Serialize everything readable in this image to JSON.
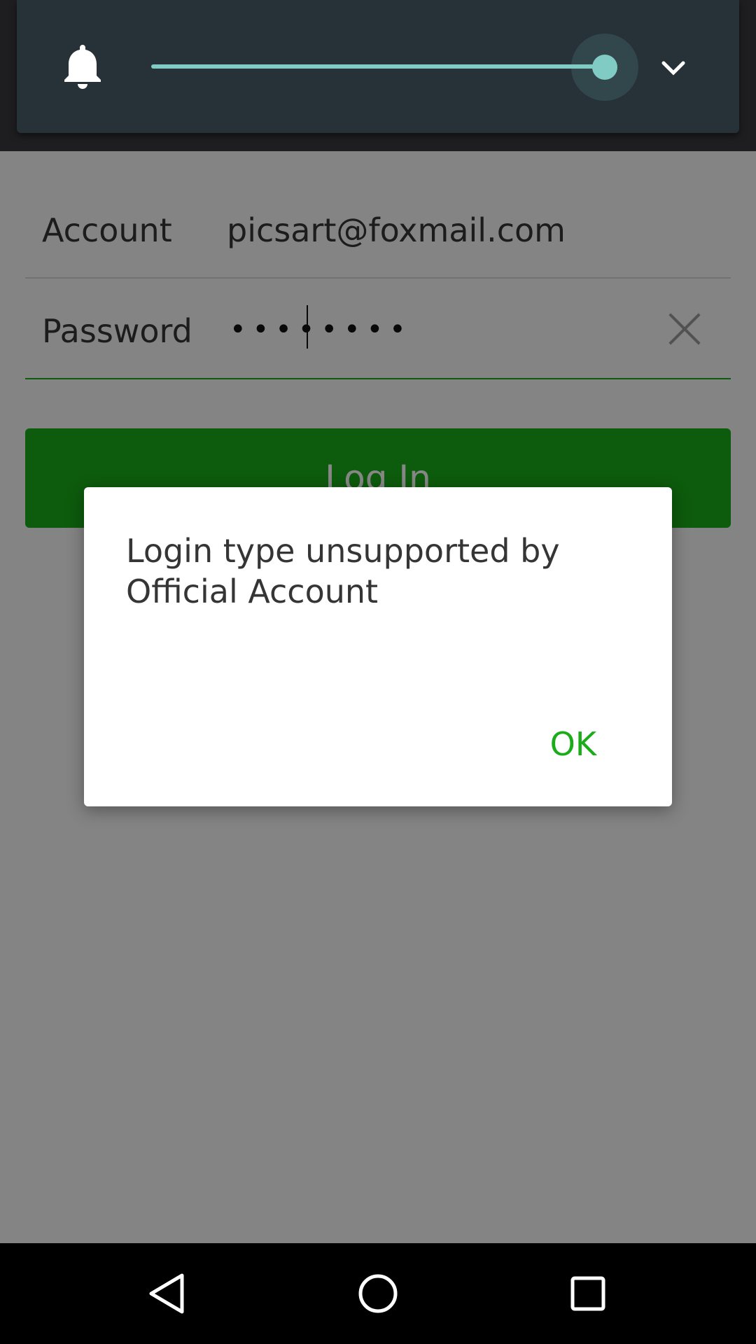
{
  "login": {
    "account_label": "Account",
    "account_value": "picsart@foxmail.com",
    "password_label": "Password",
    "password_mask": "••••••••",
    "login_button": "Log In"
  },
  "volume_panel": {
    "icon": "bell-icon",
    "expand_icon": "chevron-down-icon",
    "level": 1.0,
    "accent_color": "#80cbc4"
  },
  "dialog": {
    "message": "Login type unsupported by Official Account",
    "ok_label": "OK"
  },
  "nav_bar": {
    "back_icon": "back-icon",
    "home_icon": "home-icon",
    "recents_icon": "recents-icon"
  },
  "colors": {
    "brand_green": "#1aad19",
    "panel_bg": "#263238"
  }
}
